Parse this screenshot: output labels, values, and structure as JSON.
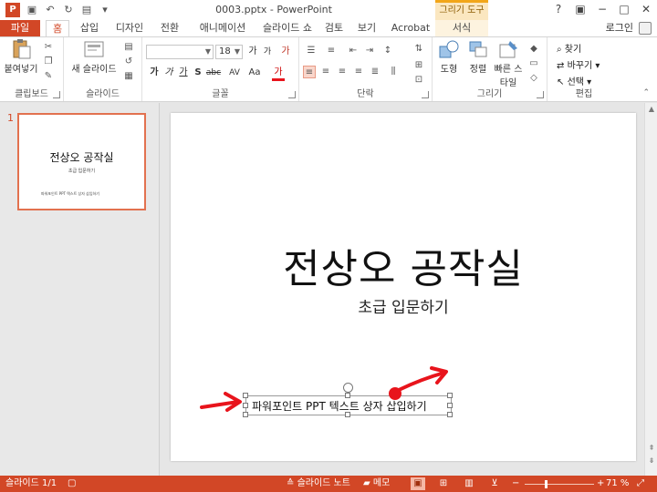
{
  "titlebar": {
    "app_icon": "P",
    "document_title": "0003.pptx - PowerPoint",
    "context_title": "그리기 도구",
    "qat_icons": [
      "save-icon",
      "undo-icon",
      "redo-icon",
      "present-icon",
      "customize-icon"
    ],
    "help": "?",
    "ribbon_display": "▣",
    "minimize": "−",
    "maximize": "□",
    "close": "✕"
  },
  "tabs": {
    "file": "파일",
    "home": "홈",
    "insert": "삽입",
    "design": "디자인",
    "transitions": "전환",
    "animations": "애니메이션",
    "slideshow": "슬라이드 쇼",
    "review": "검토",
    "view": "보기",
    "acrobat": "Acrobat",
    "format": "서식",
    "login": "로그인"
  },
  "ribbon": {
    "clipboard": {
      "paste": "붙여넣기",
      "label": "클립보드"
    },
    "slides": {
      "new_slide": "새 슬라이드",
      "label": "슬라이드"
    },
    "font": {
      "font_name": "",
      "font_size": "18",
      "label": "글꼴",
      "grow": "가",
      "shrink": "가",
      "bold": "가",
      "italic": "가",
      "underline": "가",
      "shadow": "S",
      "strike": "abc",
      "spacing": "AV",
      "case": "Aa",
      "clear": "가",
      "color": "가"
    },
    "paragraph": {
      "label": "단락"
    },
    "drawing": {
      "shapes": "도형",
      "arrange": "정렬",
      "quick_styles": "빠른 스타일",
      "label": "그리기"
    },
    "editing": {
      "find": "찾기",
      "replace": "바꾸기",
      "select": "선택",
      "label": "편집"
    }
  },
  "thumbnail": {
    "number": "1",
    "title": "전상오 공작실",
    "subtitle": "초급 입문하기",
    "textbox": "파워포인트 PPT 텍스트 상자 삽입하기"
  },
  "slide": {
    "title": "전상오 공작실",
    "subtitle": "초급 입문하기",
    "textbox": "파워포인트 PPT 텍스트 상자 삽입하기"
  },
  "statusbar": {
    "slide_info": "슬라이드 1/1",
    "notes": "슬라이드 노트",
    "comments": "메모",
    "zoom": "71 %",
    "zoom_minus": "−",
    "zoom_plus": "+"
  },
  "colors": {
    "accent": "#d24726",
    "annotation_red": "#e8141c",
    "context_tab": "#f2a619"
  }
}
